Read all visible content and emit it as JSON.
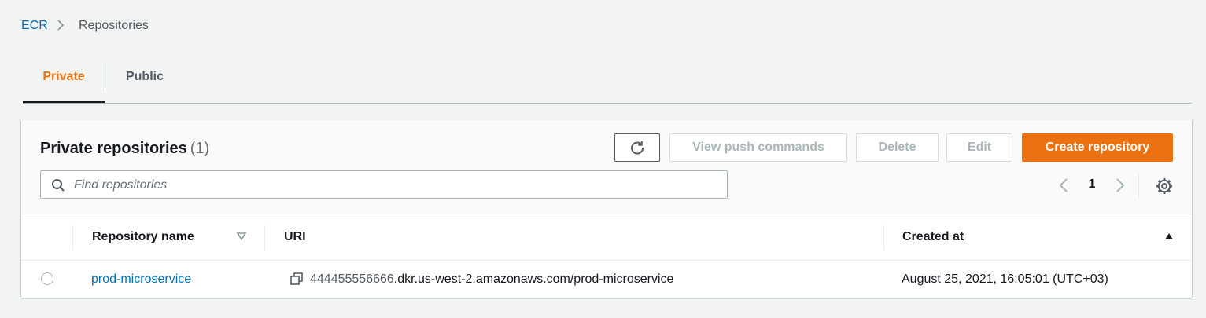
{
  "breadcrumb": {
    "root": "ECR",
    "current": "Repositories"
  },
  "tabs": [
    {
      "label": "Private",
      "active": true
    },
    {
      "label": "Public",
      "active": false
    }
  ],
  "panel": {
    "title": "Private repositories",
    "count": "(1)",
    "buttons": {
      "view_push": "View push commands",
      "delete": "Delete",
      "edit": "Edit",
      "create": "Create repository"
    },
    "search": {
      "placeholder": "Find repositories",
      "value": ""
    },
    "pagination": {
      "current_page": "1"
    }
  },
  "table": {
    "columns": {
      "name": "Repository name",
      "uri": "URI",
      "created": "Created at"
    },
    "rows": [
      {
        "name": "prod-microservice",
        "uri_account": "444455556666",
        "uri_rest": ".dkr.us-west-2.amazonaws.com/prod-microservice",
        "created": "August 25, 2021, 16:05:01 (UTC+03)"
      }
    ]
  },
  "colors": {
    "accent": "#ec7211",
    "link": "#0073bb",
    "background": "#f2f3f3"
  },
  "icons": [
    "chevron-right-icon",
    "refresh-icon",
    "search-icon",
    "chevron-left-icon",
    "gear-icon",
    "sort-down-icon",
    "sort-up-icon",
    "copy-icon"
  ]
}
